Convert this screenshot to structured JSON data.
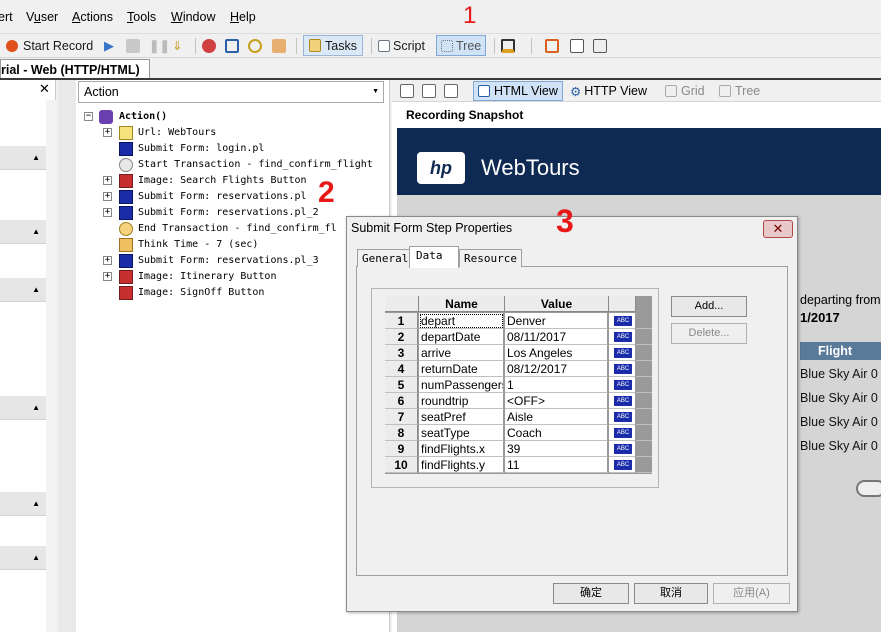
{
  "menubar": {
    "items": [
      "ert",
      "Vuser",
      "Actions",
      "Tools",
      "Window",
      "Help"
    ],
    "underline": [
      "",
      "u",
      "A",
      "T",
      "W",
      "H"
    ]
  },
  "toolbar": {
    "start_record": "Start Record",
    "tasks": "Tasks",
    "script": "Script",
    "tree": "Tree"
  },
  "doc_tab": "rial - Web (HTTP/HTML)",
  "action_selector": "Action",
  "tree": {
    "root": "Action()",
    "items": [
      {
        "text": "Url: WebTours",
        "icon": "url-icon",
        "expand": true
      },
      {
        "text": "Submit Form: login.pl",
        "icon": "submit-form-icon",
        "expand": false
      },
      {
        "text": "Start Transaction -  find_confirm_flight",
        "icon": "start-transaction-icon",
        "expand": false
      },
      {
        "text": "Image: Search Flights Button",
        "icon": "image-icon",
        "expand": true
      },
      {
        "text": "Submit Form: reservations.pl",
        "icon": "submit-form-icon",
        "expand": true
      },
      {
        "text": "Submit Form: reservations.pl_2",
        "icon": "submit-form-icon",
        "expand": true
      },
      {
        "text": "End Transaction -  find_confirm_fl",
        "icon": "end-transaction-icon",
        "expand": false
      },
      {
        "text": "Think Time - 7 (sec)",
        "icon": "hourglass-icon",
        "expand": false
      },
      {
        "text": "Submit Form: reservations.pl_3",
        "icon": "submit-form-icon",
        "expand": true
      },
      {
        "text": "Image: Itinerary Button",
        "icon": "image-icon",
        "expand": true
      },
      {
        "text": "Image: SignOff Button",
        "icon": "image-icon",
        "expand": false
      }
    ]
  },
  "right_toolbar": {
    "html_view": "HTML View",
    "http_view": "HTTP View",
    "grid": "Grid",
    "tree": "Tree"
  },
  "snapshot": {
    "heading": "Recording Snapshot",
    "logo": "hp",
    "site_title": "WebTours",
    "depart_text": "departing from",
    "depart_date": "1/2017",
    "flight_header": "Flight",
    "flights": [
      "Blue Sky Air 0",
      "Blue Sky Air 0",
      "Blue Sky Air 0",
      "Blue Sky Air 0"
    ]
  },
  "dialog": {
    "title": "Submit Form Step Properties",
    "tabs": [
      "General",
      "Data",
      "Resource"
    ],
    "columns": [
      "Name",
      "Value"
    ],
    "rows": [
      {
        "n": "1",
        "name": "depart",
        "value": "Denver"
      },
      {
        "n": "2",
        "name": "departDate",
        "value": "08/11/2017"
      },
      {
        "n": "3",
        "name": "arrive",
        "value": "Los Angeles"
      },
      {
        "n": "4",
        "name": "returnDate",
        "value": "08/12/2017"
      },
      {
        "n": "5",
        "name": "numPassengers",
        "value": "1"
      },
      {
        "n": "6",
        "name": "roundtrip",
        "value": "<OFF>"
      },
      {
        "n": "7",
        "name": "seatPref",
        "value": "Aisle"
      },
      {
        "n": "8",
        "name": "seatType",
        "value": "Coach"
      },
      {
        "n": "9",
        "name": "findFlights.x",
        "value": "39"
      },
      {
        "n": "10",
        "name": "findFlights.y",
        "value": "11"
      }
    ],
    "abc_label": "ABC",
    "add_label": "Add...",
    "delete_label": "Delete...",
    "ok_label": "确定",
    "cancel_label": "取消",
    "apply_label": "应用(A)"
  },
  "annotations": [
    "1",
    "2",
    "3"
  ],
  "colors": {
    "webtours_band": "#0f2a52",
    "annotation": "#e81818",
    "flight_header": "#5a7a9a"
  }
}
